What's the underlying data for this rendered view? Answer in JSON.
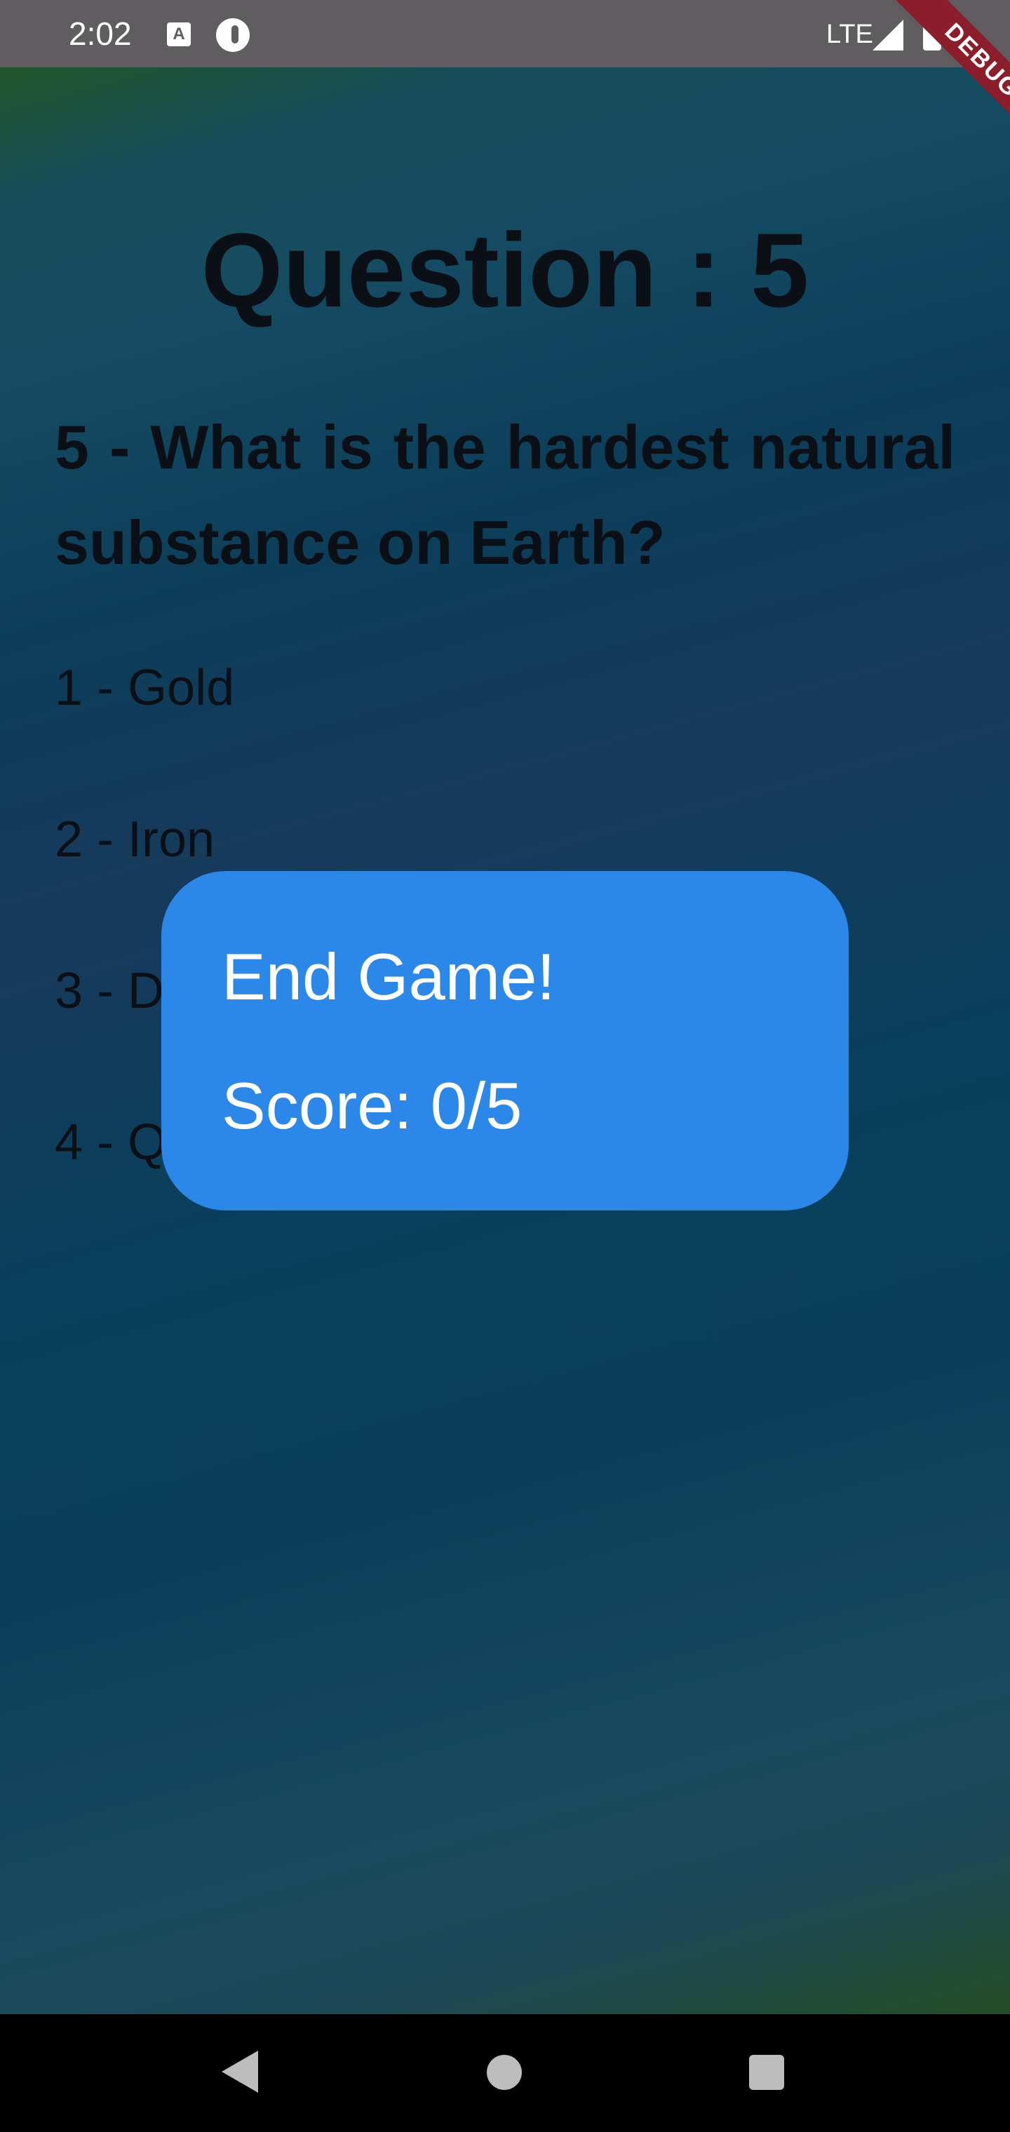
{
  "status_bar": {
    "time": "2:02",
    "network": "LTE",
    "icons": [
      "text-a-icon",
      "app-icon",
      "signal-icon",
      "battery-icon"
    ]
  },
  "debug_banner": "DEBUG",
  "quiz": {
    "heading": "Question : 5",
    "question": "5 - What is the hardest natural substance on Earth?",
    "answers": [
      "1 - Gold",
      "2 - Iron",
      "3 - D",
      "4 - Q"
    ]
  },
  "dialog": {
    "title": "End Game!",
    "score": "Score: 0/5",
    "background": "#2b88e8"
  },
  "nav_bar": {
    "icons": [
      "back-icon",
      "home-icon",
      "recents-icon"
    ]
  }
}
